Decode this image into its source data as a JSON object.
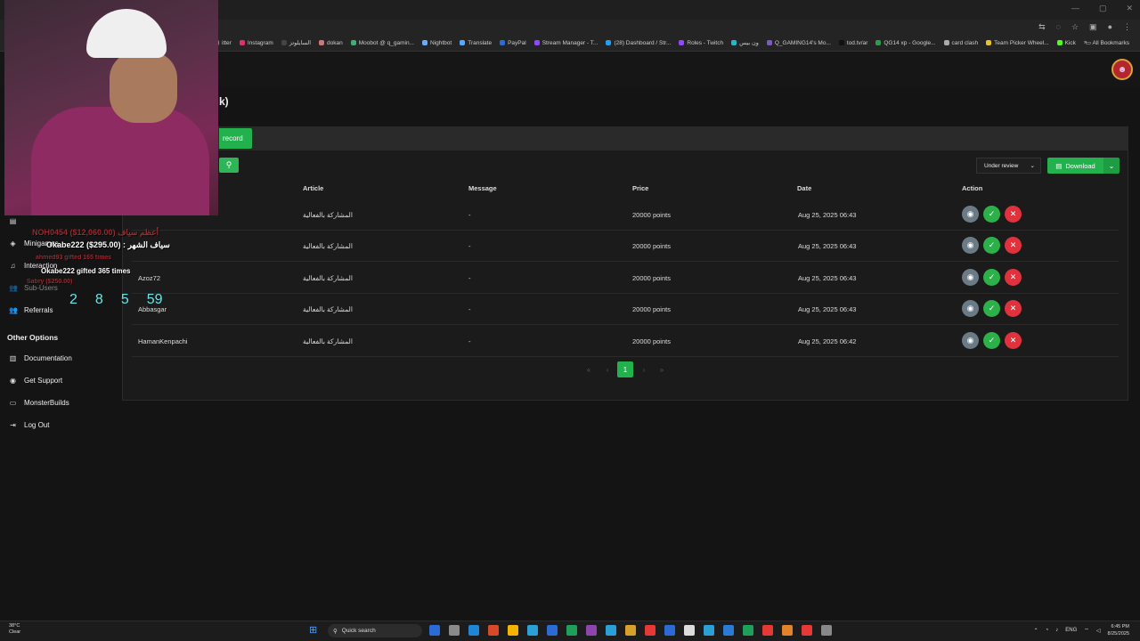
{
  "browser": {
    "bookmarks": [
      "itter",
      "Instagram",
      "السايلوتز",
      "dokan",
      "Moobot @ q_gamin...",
      "Nightbot",
      "Translate",
      "PayPal",
      "Stream Manager - T...",
      "(28) Dashboard / Str...",
      "Roles - Twitch",
      "ون بيس",
      "Q_GAMING14's Mo...",
      "tod.tv/ar",
      "QG14 xp - Google...",
      "card clash",
      "Team Picker Wheel...",
      "Kick"
    ],
    "all_bookmarks": "All Bookmarks",
    "more": "»"
  },
  "page": {
    "title_fragment": "k)",
    "add_record_fragment": "record",
    "status_filter": "Under review",
    "download_label": "Download"
  },
  "table": {
    "headers": [
      "Article",
      "Message",
      "Price",
      "Date",
      "Action"
    ],
    "rows": [
      {
        "user": "",
        "article": "المشاركة بالفعالية",
        "message": "-",
        "price": "20000 points",
        "date": "Aug 25, 2025 06:43"
      },
      {
        "user": "",
        "article": "المشاركة بالفعالية",
        "message": "-",
        "price": "20000 points",
        "date": "Aug 25, 2025 06:43"
      },
      {
        "user": "Azoz72",
        "article": "المشاركة بالفعالية",
        "message": "-",
        "price": "20000 points",
        "date": "Aug 25, 2025 06:43"
      },
      {
        "user": "Abbasgar",
        "article": "المشاركة بالفعالية",
        "message": "-",
        "price": "20000 points",
        "date": "Aug 25, 2025 06:43"
      },
      {
        "user": "HamanKenpachi",
        "article": "المشاركة بالفعالية",
        "message": "-",
        "price": "20000 points",
        "date": "Aug 25, 2025 06:42"
      }
    ]
  },
  "pagination": {
    "first": "«",
    "prev": "‹",
    "current": "1",
    "next": "›",
    "last": "»"
  },
  "sidebar": {
    "items": [
      {
        "label": "Minigames",
        "icon": "gamepad-icon"
      },
      {
        "label": "Interaction",
        "icon": "music-icon"
      },
      {
        "label": "Sub-Users",
        "icon": "users-icon"
      },
      {
        "label": "Referrals",
        "icon": "users-icon"
      }
    ],
    "other_heading": "Other Options",
    "other_items": [
      {
        "label": "Documentation",
        "icon": "book-icon"
      },
      {
        "label": "Get Support",
        "icon": "support-icon"
      },
      {
        "label": "MonsterBuilds",
        "icon": "monitor-icon"
      },
      {
        "label": "Log Out",
        "icon": "logout-icon"
      }
    ]
  },
  "stream_overlay": {
    "top_donor": "NOH0454 ($12,060.00)",
    "top_donor_label": "أعظم سياف",
    "month_sword": "Okabe222 ($295.00) : سياف الشهر",
    "gifted": "Okabe222 gifted 365 times",
    "gifted_faded": "ahmed93 gifted 165 times",
    "faded_extra": "Sabry ($250.00)",
    "counter": [
      "2",
      "8",
      "5",
      "59"
    ]
  },
  "taskbar": {
    "weather_temp": "38°C",
    "weather_desc": "Clear",
    "search_placeholder": "Quick search",
    "lang": "ENG",
    "time": "6:45 PM",
    "date": "8/25/2025"
  },
  "colors": {
    "accent_green": "#22b14c",
    "danger_red": "#e0323d",
    "view_grey": "#6b7b85"
  }
}
